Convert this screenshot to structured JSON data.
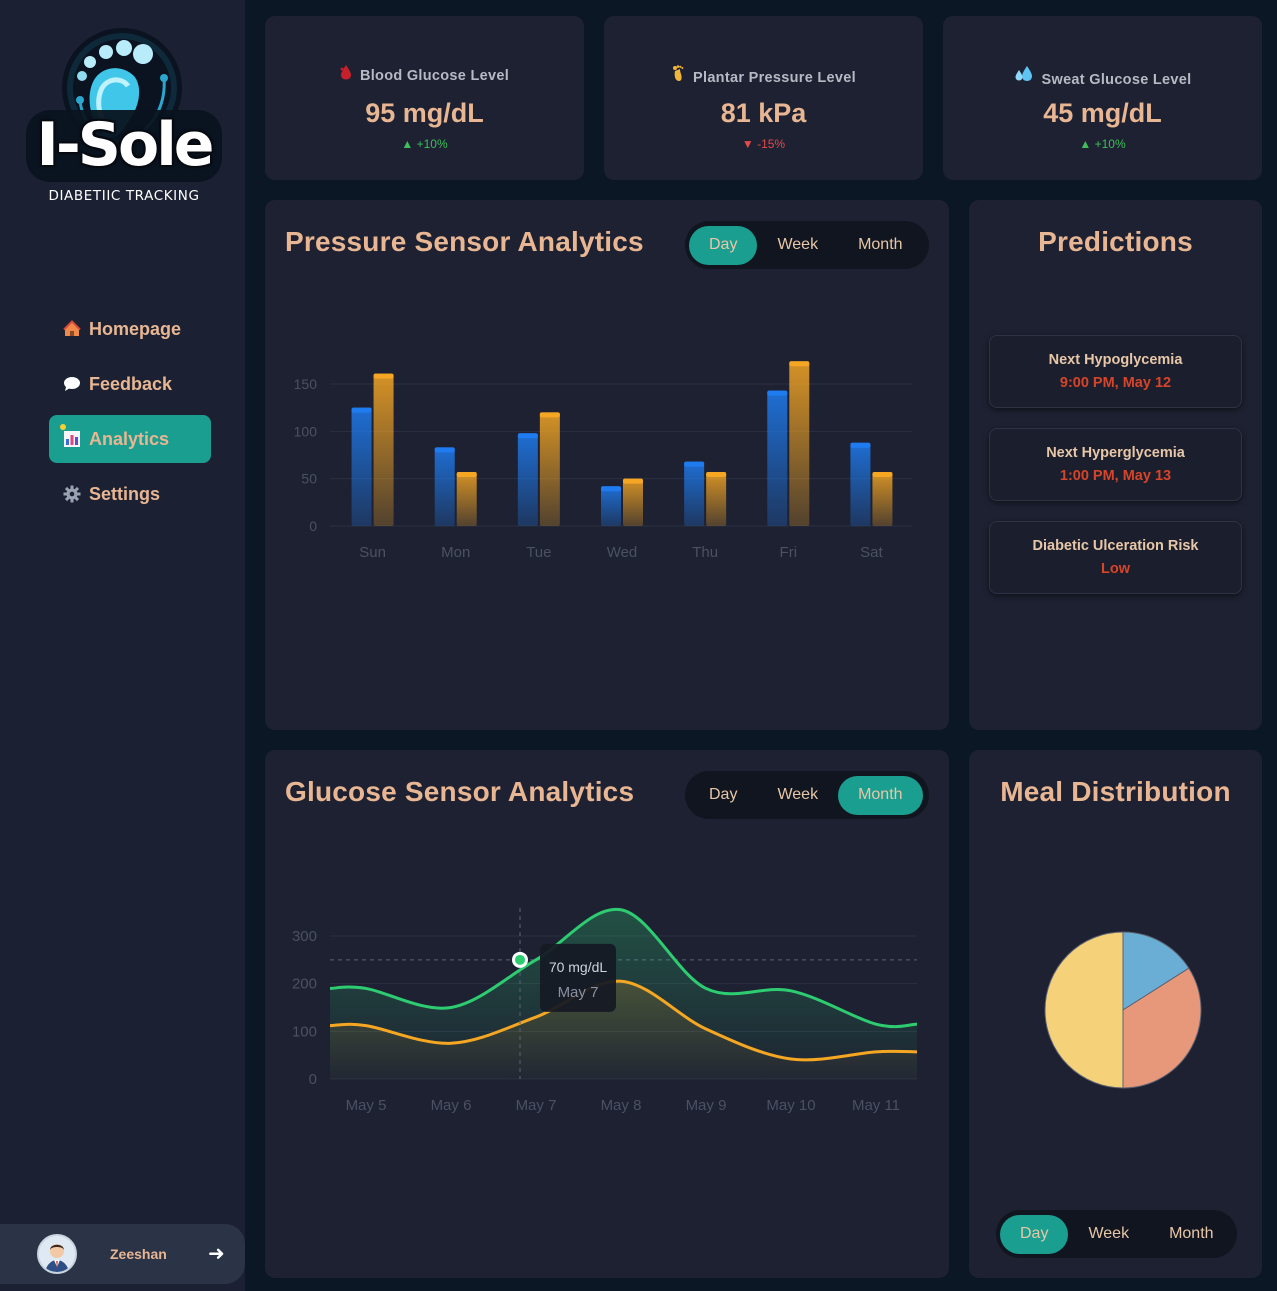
{
  "brand": {
    "name": "I-Sole",
    "tagline": "DIABETIIC TRACKING"
  },
  "nav": {
    "items": [
      {
        "label": "Homepage",
        "icon": "house-icon"
      },
      {
        "label": "Feedback",
        "icon": "speech-bubble-icon"
      },
      {
        "label": "Analytics",
        "icon": "bar-chart-icon",
        "active": true
      },
      {
        "label": "Settings",
        "icon": "gear-icon"
      }
    ]
  },
  "user": {
    "name": "Zeeshan",
    "logout_glyph": "➜"
  },
  "stats": [
    {
      "title": "Blood Glucose Level",
      "value": "95 mg/dL",
      "change": "▲ +10%",
      "icon": "blood-drop-icon"
    },
    {
      "title": "Plantar Pressure Level",
      "value": "81 kPa",
      "change": "▼ -15%",
      "icon": "foot-icon"
    },
    {
      "title": "Sweat Glucose Level",
      "value": "45 mg/dL",
      "change": "▲ +10%",
      "icon": "sweat-drops-icon"
    }
  ],
  "pressure": {
    "title": "Pressure Sensor Analytics",
    "toggle": [
      "Day",
      "Week",
      "Month"
    ],
    "active": "Day"
  },
  "glucose": {
    "title": "Glucose Sensor Analytics",
    "toggle": [
      "Day",
      "Week",
      "Month"
    ],
    "active": "Month",
    "tooltip": {
      "value": "70 mg/dL",
      "label": "May 7"
    }
  },
  "predictions": {
    "title": "Predictions",
    "items": [
      {
        "label": "Next Hypoglycemia",
        "value": "9:00 PM, May 12"
      },
      {
        "label": "Next Hyperglycemia",
        "value": "1:00 PM, May 13"
      },
      {
        "label": "Diabetic Ulceration Risk",
        "value": "Low"
      }
    ]
  },
  "meal": {
    "title": "Meal Distribution",
    "toggle": [
      "Day",
      "Week",
      "Month"
    ],
    "active": "Day"
  },
  "colors": {
    "accent": "#1a9e8f",
    "blue_series": "#1f7cf0",
    "orange_series": "#f5a623",
    "green_series": "#2ecc71",
    "title": "#e8b692"
  },
  "chart_data": [
    {
      "type": "bar",
      "categories": [
        "Sun",
        "Mon",
        "Tue",
        "Wed",
        "Thu",
        "Fri",
        "Sat"
      ],
      "series": [
        {
          "values": [
            125,
            83,
            98,
            42,
            68,
            143,
            88
          ]
        },
        {
          "values": [
            161,
            57,
            120,
            50,
            57,
            174,
            57
          ]
        }
      ],
      "yticks": [
        0,
        50,
        100,
        150
      ],
      "ylim": [
        0,
        150
      ],
      "grid": true
    },
    {
      "type": "line",
      "categories": [
        "May 5",
        "May 6",
        "May 7",
        "May 8",
        "May 9",
        "May 10",
        "May 11"
      ],
      "series": [
        {
          "values": [
            190,
            150,
            250,
            355,
            190,
            185,
            115
          ]
        },
        {
          "values": [
            112,
            75,
            130,
            205,
            105,
            42,
            57
          ]
        }
      ],
      "yticks": [
        0,
        100,
        200,
        300
      ],
      "ylim": [
        0,
        300
      ],
      "reference_line": 250,
      "grid": true
    },
    {
      "type": "pie",
      "slices": [
        {
          "value": 16,
          "color": "#6aaed6"
        },
        {
          "value": 34,
          "color": "#e8987a"
        },
        {
          "value": 50,
          "color": "#f5d27a"
        }
      ]
    }
  ]
}
